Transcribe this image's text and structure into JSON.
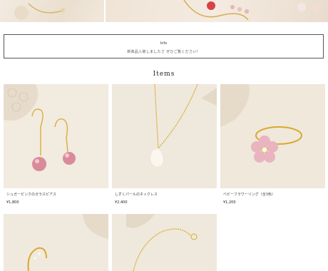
{
  "info": {
    "title": "Info",
    "text": "新商品入荷しましたさ ぜひご覧ください！"
  },
  "items_section": {
    "title": "Items"
  },
  "products": [
    {
      "name": "シュガーピンクのガラスピアス",
      "price": "¥1,800"
    },
    {
      "name": "しずくパールのネックレス",
      "price": "¥2,400"
    },
    {
      "name": "ベビーフラワーリング（全3色）",
      "price": "¥1,200"
    }
  ],
  "colors": {
    "background": "#ffffff",
    "image_base": "#f0e9dd",
    "gold": "#d9a92e",
    "pink": "#d98a9b"
  }
}
